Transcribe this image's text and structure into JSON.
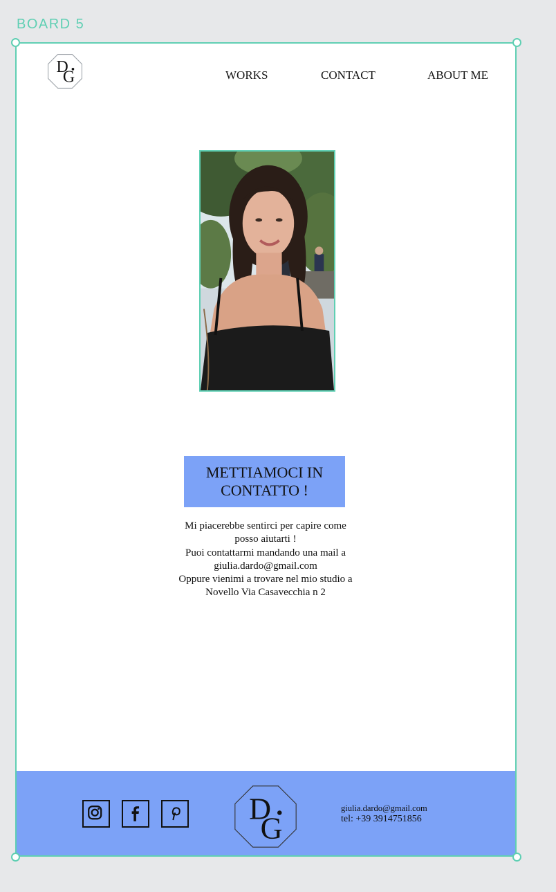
{
  "board": {
    "label": "BOARD 5"
  },
  "logo": {
    "letters": "DG",
    "d": "D",
    "g": "G"
  },
  "nav": {
    "works": "WORKS",
    "contact": "CONTACT",
    "about": "ABOUT ME"
  },
  "cta": {
    "line1": "METTIAMOCI IN",
    "line2": "CONTATTO !"
  },
  "body": {
    "lines": [
      "Mi piacerebbe sentirci  per capire come",
      "posso aiutarti !",
      "Puoi contattarmi  mandando una mail a",
      "giulia.dardo@gmail.com",
      "Oppure vienimi a trovare nel mio studio a",
      "Novello Via Casavecchia n 2"
    ]
  },
  "footer": {
    "email": "giulia.dardo@gmail.com",
    "tel": "tel:  +39 3914751856",
    "social": [
      "instagram-icon",
      "facebook-icon",
      "pinterest-icon"
    ]
  },
  "colors": {
    "accent": "#5fcfb3",
    "brand_blue": "#7ca2f7",
    "canvas": "#e7e8ea"
  }
}
